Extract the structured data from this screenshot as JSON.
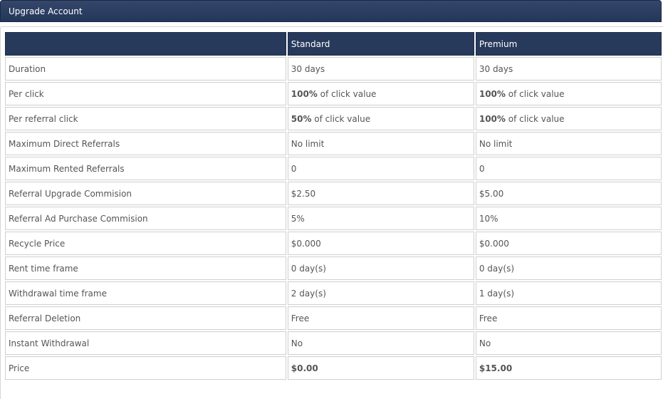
{
  "header": {
    "title": "Upgrade Account"
  },
  "table": {
    "columns": [
      "",
      "Standard",
      "Premium"
    ],
    "rows": [
      {
        "label": "Duration",
        "standard": {
          "text": "30 days"
        },
        "premium": {
          "text": "30 days"
        }
      },
      {
        "label": "Per click",
        "standard": {
          "bold": "100%",
          "text": " of click value"
        },
        "premium": {
          "bold": "100%",
          "text": " of click value"
        }
      },
      {
        "label": "Per referral click",
        "standard": {
          "bold": "50%",
          "text": " of click value"
        },
        "premium": {
          "bold": "100%",
          "text": " of click value"
        }
      },
      {
        "label": "Maximum Direct Referrals",
        "standard": {
          "text": "No limit"
        },
        "premium": {
          "text": "No limit"
        }
      },
      {
        "label": "Maximum Rented Referrals",
        "standard": {
          "text": "0"
        },
        "premium": {
          "text": "0"
        }
      },
      {
        "label": "Referral Upgrade Commision",
        "standard": {
          "text": "$2.50"
        },
        "premium": {
          "text": "$5.00"
        }
      },
      {
        "label": "Referral Ad Purchase Commision",
        "standard": {
          "text": "5%"
        },
        "premium": {
          "text": "10%"
        }
      },
      {
        "label": "Recycle Price",
        "standard": {
          "text": "$0.000"
        },
        "premium": {
          "text": "$0.000"
        }
      },
      {
        "label": "Rent time frame",
        "standard": {
          "text": "0 day(s)"
        },
        "premium": {
          "text": "0 day(s)"
        }
      },
      {
        "label": "Withdrawal time frame",
        "standard": {
          "text": "2 day(s)"
        },
        "premium": {
          "text": "1 day(s)"
        }
      },
      {
        "label": "Referral Deletion",
        "standard": {
          "text": "Free"
        },
        "premium": {
          "text": "Free"
        }
      },
      {
        "label": "Instant Withdrawal",
        "standard": {
          "text": "No"
        },
        "premium": {
          "text": "No"
        }
      },
      {
        "label": "Price",
        "standard": {
          "bold": "$0.00",
          "text": ""
        },
        "premium": {
          "bold": "$15.00",
          "text": ""
        }
      }
    ]
  }
}
